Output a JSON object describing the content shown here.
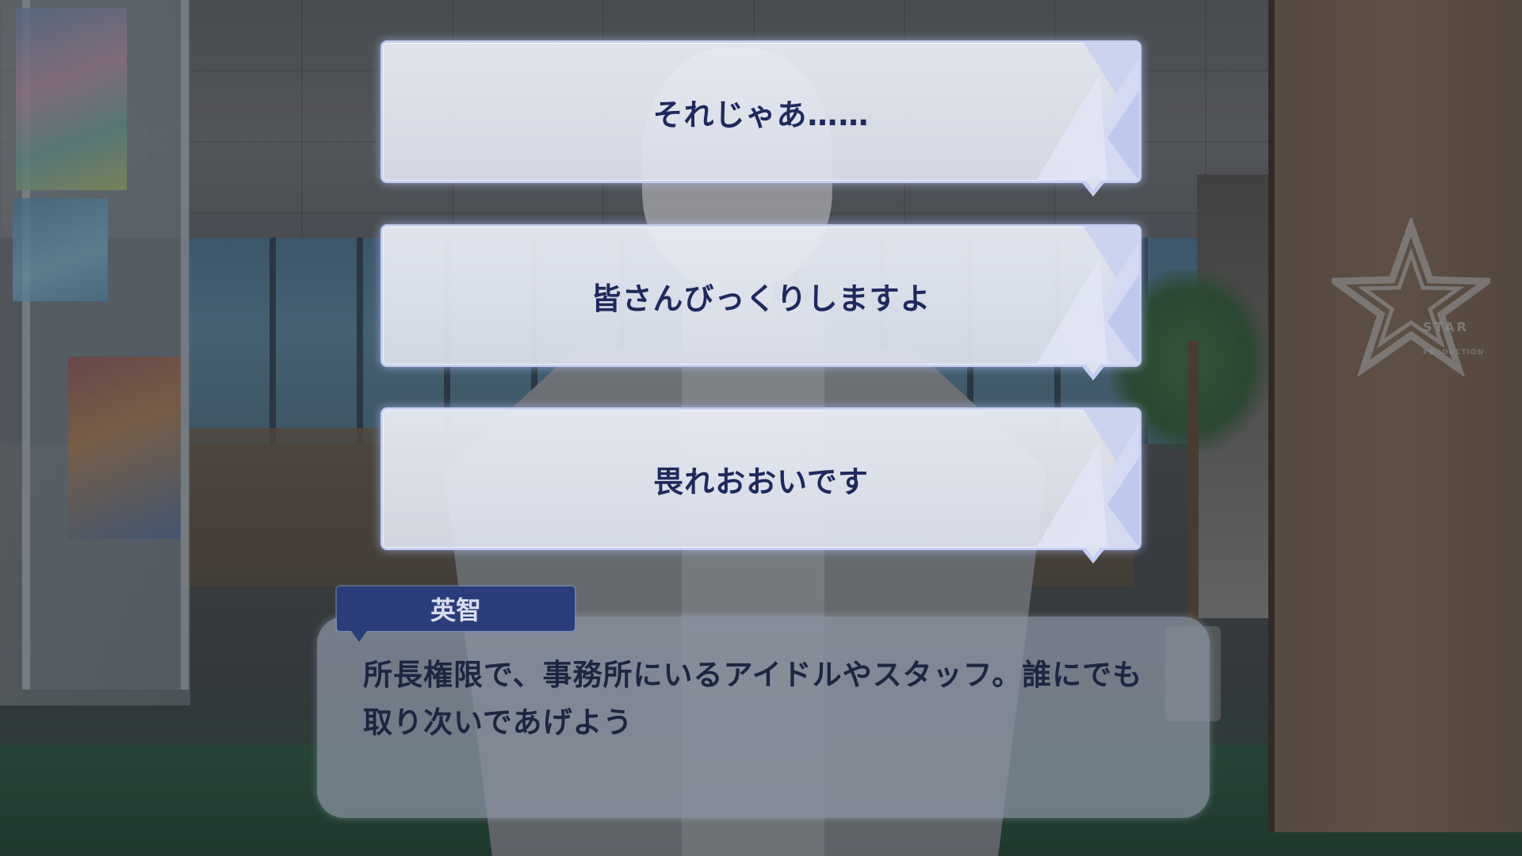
{
  "scene": {
    "background": "agency-office",
    "logo_text": "STAR",
    "logo_subtext": "PRODUCTION"
  },
  "choices": [
    {
      "label": "それじゃあ……"
    },
    {
      "label": "皆さんびっくりしますよ"
    },
    {
      "label": "畏れおおいです"
    }
  ],
  "dialogue": {
    "speaker": "英智",
    "text": "所長権限で、事務所にいるアイドルやスタッフ。誰にでも取り次いであげよう"
  },
  "colors": {
    "choice_border": "#c6cff2",
    "choice_text": "#1e2a5c",
    "name_plate": "#2a3d7a",
    "dialogue_text": "#1d2540"
  }
}
